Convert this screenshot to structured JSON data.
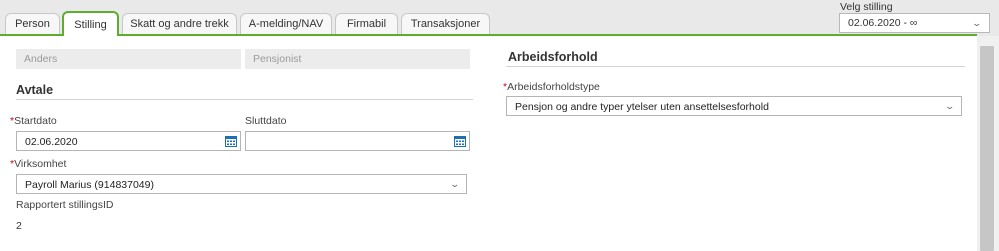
{
  "tabs": [
    {
      "label": "Person",
      "active": false
    },
    {
      "label": "Stilling",
      "active": true
    },
    {
      "label": "Skatt og andre trekk",
      "active": false
    },
    {
      "label": "A-melding/NAV",
      "active": false
    },
    {
      "label": "Firmabil",
      "active": false
    },
    {
      "label": "Transaksjoner",
      "active": false
    }
  ],
  "velg_stilling": {
    "label": "Velg stilling",
    "value": "02.06.2020 - ∞"
  },
  "employee": {
    "first_name": "Anders",
    "last_name": "Pensjonist"
  },
  "avtale": {
    "title": "Avtale",
    "startdato_label": "Startdato",
    "startdato_value": "02.06.2020",
    "sluttdato_label": "Sluttdato",
    "sluttdato_value": "",
    "virksomhet_label": "Virksomhet",
    "virksomhet_value": "Payroll Marius (914837049)",
    "stillingsid_label": "Rapportert stillingsID",
    "stillingsid_value": "2"
  },
  "arbeidsforhold": {
    "title": "Arbeidsforhold",
    "type_label": "Arbeidsforholdstype",
    "type_value": "Pensjon og andre typer ytelser uten ansettelsesforhold"
  },
  "colors": {
    "accent": "#5fad2e",
    "required": "#d0021b",
    "calendar": "#1a6fb5"
  }
}
